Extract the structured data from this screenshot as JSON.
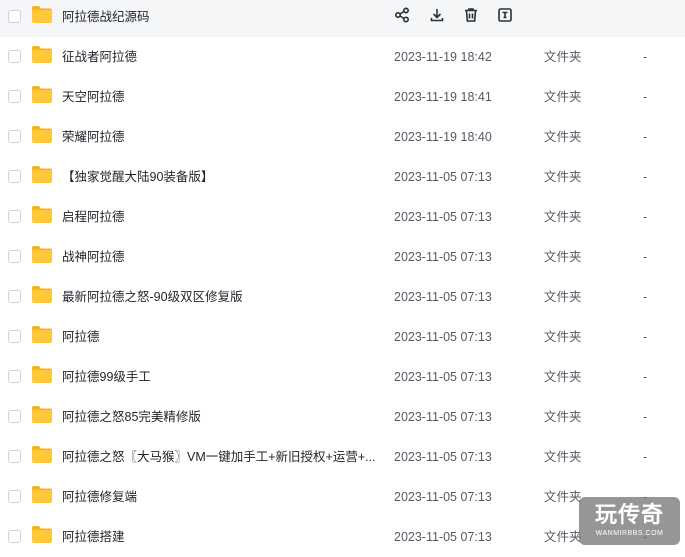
{
  "files": [
    {
      "name": "阿拉德战纪源码",
      "time": "",
      "type": "",
      "size": ""
    },
    {
      "name": "征战者阿拉德",
      "time": "2023-11-19 18:42",
      "type": "文件夹",
      "size": "-"
    },
    {
      "name": "天空阿拉德",
      "time": "2023-11-19 18:41",
      "type": "文件夹",
      "size": "-"
    },
    {
      "name": "荣耀阿拉德",
      "time": "2023-11-19 18:40",
      "type": "文件夹",
      "size": "-"
    },
    {
      "name": "【独家觉醒大陆90装备版】",
      "time": "2023-11-05 07:13",
      "type": "文件夹",
      "size": "-"
    },
    {
      "name": "启程阿拉德",
      "time": "2023-11-05 07:13",
      "type": "文件夹",
      "size": "-"
    },
    {
      "name": "战神阿拉德",
      "time": "2023-11-05 07:13",
      "type": "文件夹",
      "size": "-"
    },
    {
      "name": "最新阿拉德之怒-90级双区修复版",
      "time": "2023-11-05 07:13",
      "type": "文件夹",
      "size": "-"
    },
    {
      "name": "阿拉德",
      "time": "2023-11-05 07:13",
      "type": "文件夹",
      "size": "-"
    },
    {
      "name": "阿拉德99级手工",
      "time": "2023-11-05 07:13",
      "type": "文件夹",
      "size": "-"
    },
    {
      "name": "阿拉德之怒85完美精修版",
      "time": "2023-11-05 07:13",
      "type": "文件夹",
      "size": "-"
    },
    {
      "name": "阿拉德之怒〖大马猴〗VM一键加手工+新旧授权+运营+...",
      "time": "2023-11-05 07:13",
      "type": "文件夹",
      "size": "-"
    },
    {
      "name": "阿拉德修复端",
      "time": "2023-11-05 07:13",
      "type": "文件夹",
      "size": "-"
    },
    {
      "name": "阿拉德搭建",
      "time": "2023-11-05 07:13",
      "type": "文件夹",
      "size": "-"
    }
  ],
  "row_actions": [
    "share-icon",
    "download-icon",
    "delete-icon",
    "rename-icon"
  ],
  "colors": {
    "folder": "#ffc73a",
    "folder_tab": "#f5b21c",
    "hover_bg": "#f5f6f8",
    "icon": "#2b2f36"
  },
  "watermark": {
    "main": "玩传奇",
    "sub": "WANMIRBBS.COM"
  }
}
